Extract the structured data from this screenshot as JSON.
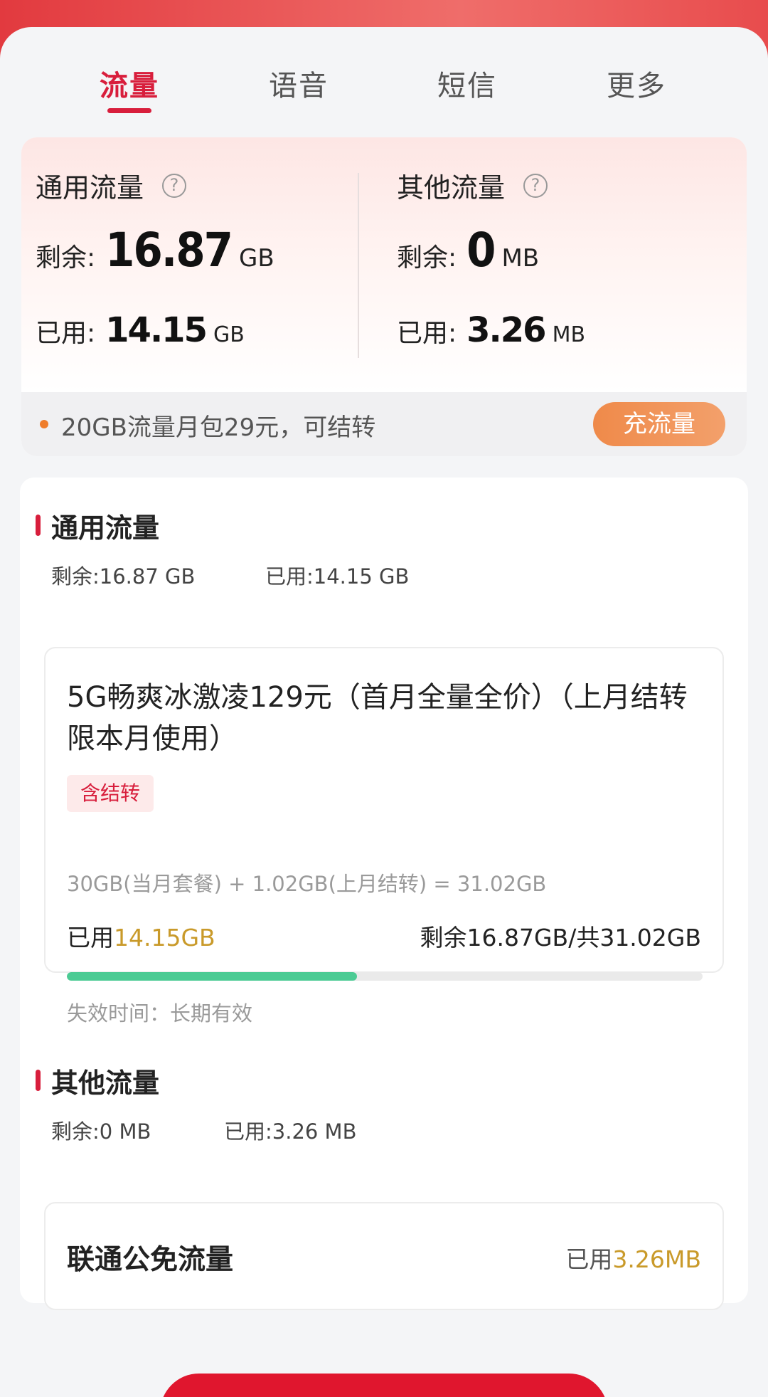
{
  "tabs": [
    {
      "label": "流量",
      "active": true
    },
    {
      "label": "语音",
      "active": false
    },
    {
      "label": "短信",
      "active": false
    },
    {
      "label": "更多",
      "active": false
    }
  ],
  "summary": {
    "general": {
      "title": "通用流量",
      "remaining_label": "剩余:",
      "remaining_value": "16.87",
      "remaining_unit": "GB",
      "used_label": "已用:",
      "used_value": "14.15",
      "used_unit": "GB"
    },
    "other": {
      "title": "其他流量",
      "remaining_label": "剩余:",
      "remaining_value": "0",
      "remaining_unit": "MB",
      "used_label": "已用:",
      "used_value": "3.26",
      "used_unit": "MB"
    },
    "help_icon": "question-circle-icon"
  },
  "promo": {
    "text": "20GB流量月包29元，可结转",
    "button_label": "充流量"
  },
  "general_section": {
    "title": "通用流量",
    "remaining": "剩余:16.87 GB",
    "used": "已用:14.15 GB",
    "package": {
      "name": "5G畅爽冰激凌129元（首月全量全价）（上月结转限本月使用）",
      "tag": "含结转",
      "formula": "30GB(当月套餐) + 1.02GB(上月结转) = 31.02GB",
      "used_prefix": "已用",
      "used_value": "14.15GB",
      "remaining_text": "剩余16.87GB/共31.02GB",
      "used_fraction": 0.456,
      "expiry": "失效时间：长期有效"
    }
  },
  "other_section": {
    "title": "其他流量",
    "remaining": "剩余:0 MB",
    "used": "已用:3.26 MB",
    "item": {
      "name": "联通公免流量",
      "used_prefix": "已用",
      "used_value": "3.26MB"
    }
  },
  "colors": {
    "brand_red": "#d81e3c",
    "progress_green": "#4ccb94",
    "gold": "#c99a2a",
    "promo_orange": "#ef8a4a"
  }
}
